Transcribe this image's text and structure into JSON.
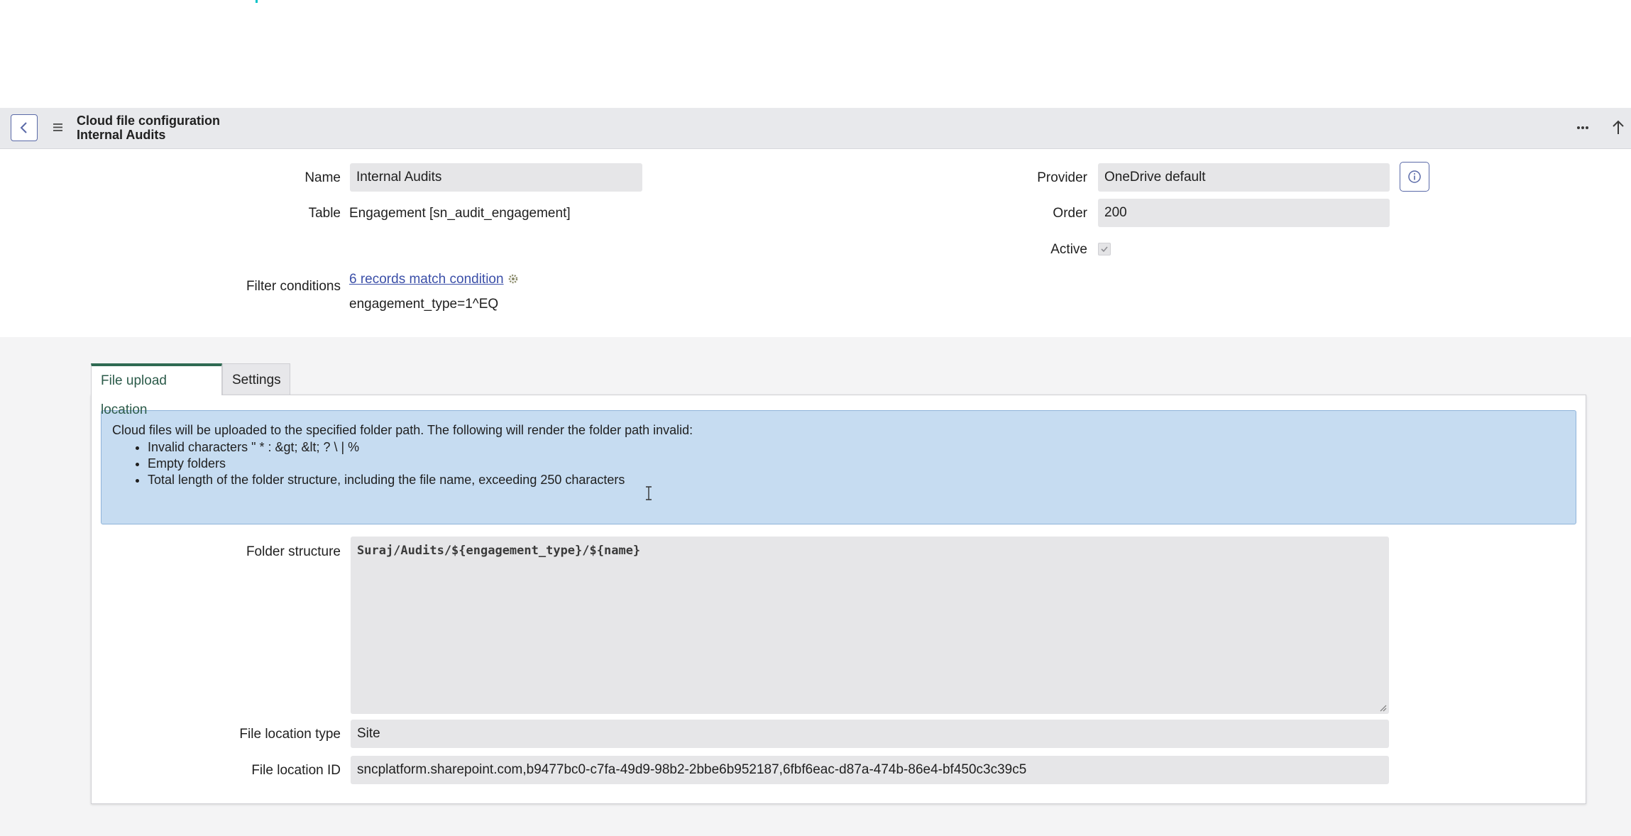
{
  "header": {
    "title": "Cloud file configuration",
    "subtitle": "Internal Audits",
    "icons": [
      "chevron-left-icon",
      "hamburger-menu-icon",
      "more-options-icon",
      "arrow-up-icon"
    ]
  },
  "form": {
    "name": {
      "label": "Name",
      "value": "Internal Audits"
    },
    "table": {
      "label": "Table",
      "value": "Engagement [sn_audit_engagement]"
    },
    "filter": {
      "label": "Filter conditions",
      "link": "6 records match condition",
      "condition": "engagement_type=1^EQ"
    },
    "provider": {
      "label": "Provider",
      "value": "OneDrive default"
    },
    "order": {
      "label": "Order",
      "value": "200"
    },
    "active": {
      "label": "Active",
      "checked": true
    }
  },
  "tabs": [
    {
      "label": "File upload location",
      "active": true
    },
    {
      "label": "Settings",
      "active": false
    }
  ],
  "notice": {
    "intro": "Cloud files will be uploaded to the specified folder path. The following will render the folder path invalid:",
    "items": [
      "Invalid characters \" * : &gt; &lt; ? \\ | %",
      "Empty folders",
      "Total length of the folder structure, including the file name, exceeding 250 characters"
    ],
    "color": "#c6dcf1"
  },
  "upload": {
    "folder_structure": {
      "label": "Folder structure",
      "value": "Suraj/Audits/${engagement_type}/${name}"
    },
    "file_location_type": {
      "label": "File location type",
      "value": "Site"
    },
    "file_location_id": {
      "label": "File location ID",
      "value": "sncplatform.sharepoint.com,b9477bc0-c7fa-49d9-98b2-2bbe6b952187,6fbf6eac-d87a-474b-86e4-bf450c3c39c5"
    }
  },
  "colors": {
    "header_bg": "#e8e9ec",
    "accent_border": "#5a6aa8",
    "active_tab": "#2f6a52",
    "link": "#3b4fa8"
  }
}
